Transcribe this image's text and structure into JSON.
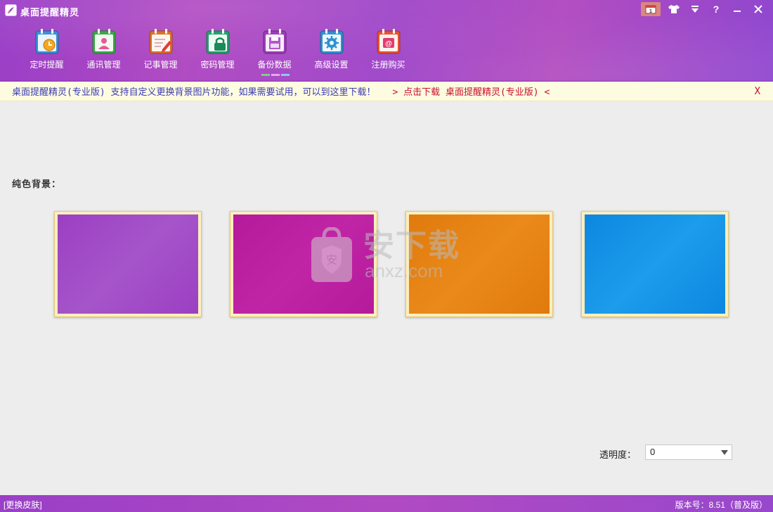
{
  "app": {
    "title": "桌面提醒精灵"
  },
  "window_controls": [
    {
      "name": "calendar",
      "glyph": "1"
    },
    {
      "name": "skin",
      "glyph": "👕"
    },
    {
      "name": "menu",
      "glyph": "▼"
    },
    {
      "name": "help",
      "glyph": "?"
    },
    {
      "name": "minimize",
      "glyph": "—"
    },
    {
      "name": "close",
      "glyph": "X"
    }
  ],
  "toolbar": [
    {
      "label": "定时提醒",
      "icon": "alarm-clock-icon",
      "color": "#4aa3e3"
    },
    {
      "label": "通讯管理",
      "icon": "contacts-icon",
      "color": "#3fb54a"
    },
    {
      "label": "记事管理",
      "icon": "notepad-icon",
      "color": "#e07a2a"
    },
    {
      "label": "密码管理",
      "icon": "password-icon",
      "color": "#2fb07a"
    },
    {
      "label": "备份数据",
      "icon": "backup-icon",
      "color": "#a248b8"
    },
    {
      "label": "高级设置",
      "icon": "settings-icon",
      "color": "#3a9fd8"
    },
    {
      "label": "注册购买",
      "icon": "register-icon",
      "color": "#e8503a"
    }
  ],
  "notice": {
    "message": "桌面提醒精灵(专业版) 支持自定义更换背景图片功能，如果需要试用，可以到这里下载！",
    "download": "> 点击下载 桌面提醒精灵(专业版) <",
    "close": "X"
  },
  "content": {
    "section_label": "纯色背景：",
    "swatches": [
      {
        "name": "purple",
        "color1": "#9b3fc3",
        "color2": "#a655c9"
      },
      {
        "name": "magenta",
        "color1": "#b51a9b",
        "color2": "#c025a6"
      },
      {
        "name": "orange",
        "color1": "#e07a0c",
        "color2": "#ea8a1a"
      },
      {
        "name": "blue",
        "color1": "#0d87e0",
        "color2": "#1c9ceb"
      }
    ],
    "watermark": {
      "big": "安下载",
      "small": "anxz.com"
    }
  },
  "opacity": {
    "label": "透明度：",
    "value": "0"
  },
  "statusbar": {
    "skin_link": "[更换皮肤]",
    "version": "版本号：8.51（普及版）"
  }
}
